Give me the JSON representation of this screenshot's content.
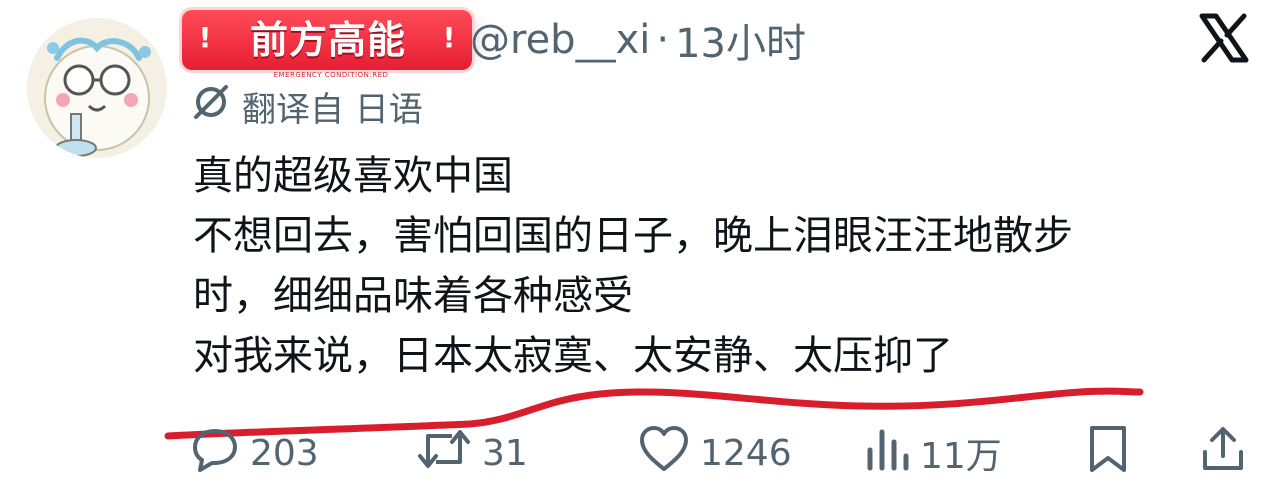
{
  "post": {
    "sticker_title": "前方高能",
    "sticker_mark_left": "!",
    "sticker_mark_right": "!",
    "sticker_subtitle": "EMERGENCY CONDITION:RED",
    "handle": "@reb__xi",
    "separator": "·",
    "time_ago": "13小时",
    "translated_from": "翻译自 日语",
    "lines": [
      "真的超级喜欢中国",
      "不想回去，害怕回国的日子，晚上泪眼汪汪地散步",
      "时，细细品味着各种感受",
      "对我来说，日本太寂寞、太安静、太压抑了"
    ]
  },
  "actions": {
    "replies": "203",
    "reposts": "31",
    "likes": "1246",
    "views": "11万"
  },
  "icons": {
    "brand": "x-logo-icon",
    "translate": "translate-icon",
    "reply": "comment-icon",
    "repost": "repost-icon",
    "like": "heart-icon",
    "views": "bar-chart-icon",
    "bookmark": "bookmark-icon",
    "share": "share-icon"
  },
  "colors": {
    "text": "#0f1419",
    "muted": "#536471",
    "sticker_red": "#e61e33",
    "underline_red": "#d81e2c"
  }
}
